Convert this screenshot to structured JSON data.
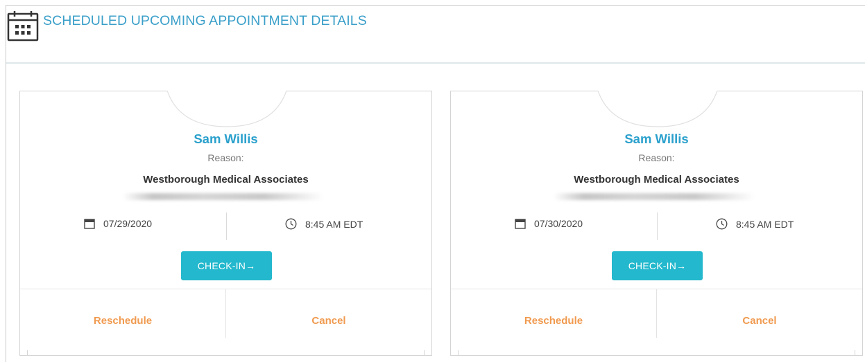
{
  "header": {
    "title": "SCHEDULED UPCOMING APPOINTMENT DETAILS",
    "icon": "calendar-icon"
  },
  "colors": {
    "accent": "#3a9fc9",
    "name": "#2aa0cc",
    "button": "#23b8cd",
    "action": "#f09a4f"
  },
  "appointments": [
    {
      "name": "Sam Willis",
      "reason_label": "Reason:",
      "practice": "Westborough Medical Associates",
      "date": "07/29/2020",
      "time": "8:45 AM EDT",
      "checkin_label": "CHECK-IN→",
      "reschedule_label": "Reschedule",
      "cancel_label": "Cancel"
    },
    {
      "name": "Sam Willis",
      "reason_label": "Reason:",
      "practice": "Westborough Medical Associates",
      "date": "07/30/2020",
      "time": "8:45 AM EDT",
      "checkin_label": "CHECK-IN→",
      "reschedule_label": "Reschedule",
      "cancel_label": "Cancel"
    }
  ]
}
